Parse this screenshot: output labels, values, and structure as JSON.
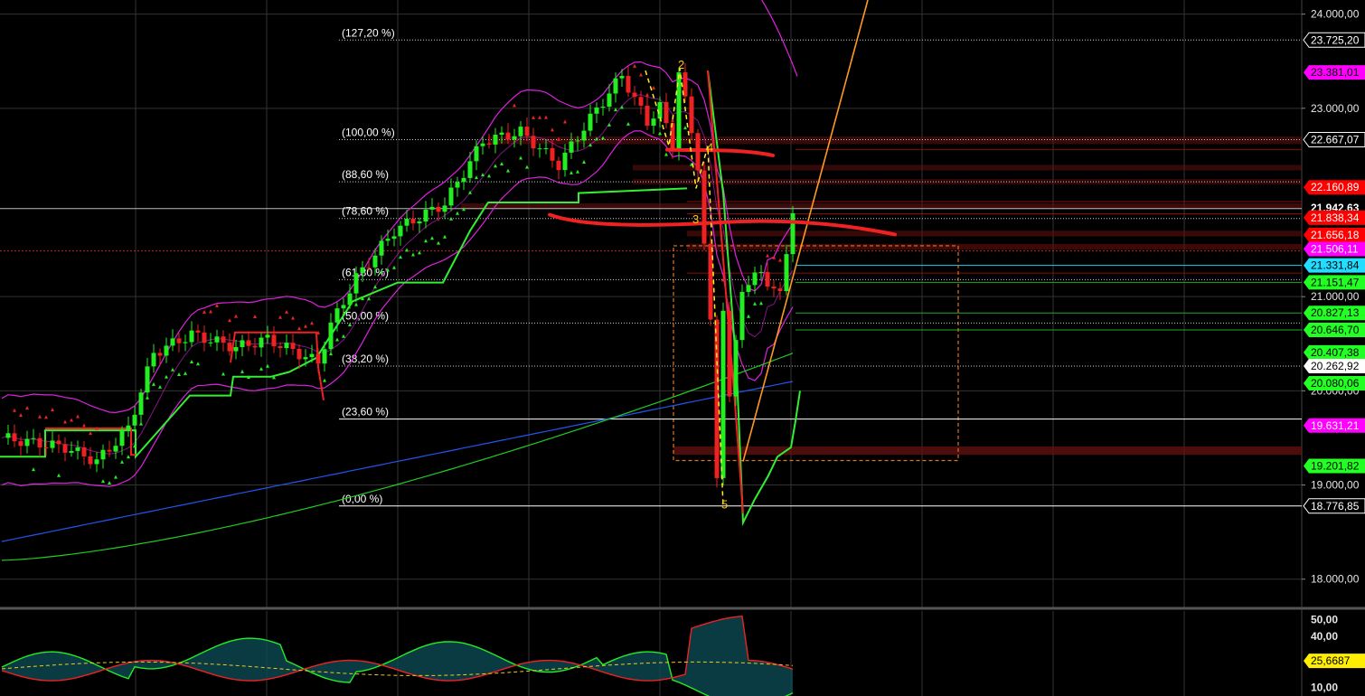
{
  "chart_data": {
    "type": "candlestick",
    "price_axis": {
      "range": [
        17700,
        24150
      ],
      "ticks": [
        {
          "value": 24000,
          "label": "24.000,00"
        },
        {
          "value": 23000,
          "label": "23.000,00"
        },
        {
          "value": 21000,
          "label": "21.000,00"
        },
        {
          "value": 20000,
          "label": "20.000,00"
        },
        {
          "value": 19000,
          "label": "19.000,00"
        },
        {
          "value": 18000,
          "label": "18.000,00"
        }
      ]
    },
    "oscillator_axis": {
      "range": [
        5,
        55
      ],
      "ticks": [
        {
          "value": 50,
          "label": "50,00"
        },
        {
          "value": 40,
          "label": "40,00"
        },
        {
          "value": 10,
          "label": "10,00"
        }
      ]
    },
    "fib_levels": [
      {
        "label": "(127,20 %)",
        "value": 23725.2,
        "color": "#cccccc",
        "style": "dotted"
      },
      {
        "label": "(100,00 %)",
        "value": 22667.07,
        "color": "#cccccc",
        "style": "dotted"
      },
      {
        "label": "(88,60 %)",
        "value": 22220,
        "color": "#cccccc",
        "style": "dotted"
      },
      {
        "label": "(78,60 %)",
        "value": 21830,
        "color": "#cccccc",
        "style": "dotted"
      },
      {
        "label": "(61,80 %)",
        "value": 21180,
        "color": "#cccccc",
        "style": "dotted"
      },
      {
        "label": "(50,00 %)",
        "value": 20720,
        "color": "#cccccc",
        "style": "dotted"
      },
      {
        "label": "(38,20 %)",
        "value": 20262.92,
        "color": "#cccccc",
        "style": "dotted"
      },
      {
        "label": "(23,60 %)",
        "value": 19700,
        "color": "#ffffff",
        "style": "solid"
      },
      {
        "label": "(0,00 %)",
        "value": 18776.85,
        "color": "#ffffff",
        "style": "solid"
      }
    ],
    "price_tags": [
      {
        "label": "23.725,20",
        "value": 23725.2,
        "bg": "#000000",
        "fg": "#ffffff",
        "border": "#ffffff"
      },
      {
        "label": "23.381,01",
        "value": 23381.01,
        "bg": "#ff00ff",
        "fg": "#000000"
      },
      {
        "label": "22.667,07",
        "value": 22667.07,
        "bg": "#000000",
        "fg": "#ffffff",
        "border": "#ffffff"
      },
      {
        "label": "22.160,89",
        "value": 22160.89,
        "bg": "#ff0000",
        "fg": "#ffffff"
      },
      {
        "label": "21.942,63",
        "value": 21942.63,
        "bg": "#000000",
        "fg": "#ffffff",
        "bold": true
      },
      {
        "label": "21.838,34",
        "value": 21838.34,
        "bg": "#ff0000",
        "fg": "#ffffff"
      },
      {
        "label": "21.656,18",
        "value": 21656.18,
        "bg": "#ff0000",
        "fg": "#ffffff"
      },
      {
        "label": "21.506,11",
        "value": 21506.11,
        "bg": "#ff00ff",
        "fg": "#ffffff"
      },
      {
        "label": "21.331,84",
        "value": 21331.84,
        "bg": "#22ddff",
        "fg": "#000000"
      },
      {
        "label": "21.151,47",
        "value": 21151.47,
        "bg": "#22ff22",
        "fg": "#000000"
      },
      {
        "label": "20.827,13",
        "value": 20827.13,
        "bg": "#22ff22",
        "fg": "#000000"
      },
      {
        "label": "20.646,70",
        "value": 20646.7,
        "bg": "#22ff22",
        "fg": "#000000"
      },
      {
        "label": "20.407,38",
        "value": 20407.38,
        "bg": "#22ff22",
        "fg": "#000000"
      },
      {
        "label": "20.262,92",
        "value": 20262.92,
        "bg": "#ffffff",
        "fg": "#000000"
      },
      {
        "label": "20.080,06",
        "value": 20080.06,
        "bg": "#22ff22",
        "fg": "#000000"
      },
      {
        "label": "19.631,21",
        "value": 19631.21,
        "bg": "#ff00ff",
        "fg": "#ffffff"
      },
      {
        "label": "19.201,82",
        "value": 19201.82,
        "bg": "#22ff22",
        "fg": "#000000"
      },
      {
        "label": "18.776,85",
        "value": 18776.85,
        "bg": "#000000",
        "fg": "#ffffff",
        "border": "#ffffff"
      }
    ],
    "oscillator_tags": [
      {
        "label": "25,6687",
        "value": 25.67,
        "bg": "#ffee00",
        "fg": "#000000"
      }
    ],
    "wave_labels": [
      {
        "label": "2",
        "value": 23420,
        "color": "#ffcc00"
      },
      {
        "label": "4",
        "value": 22540,
        "color": "#ffcc00"
      },
      {
        "label": "3",
        "value": 21780,
        "color": "#ffcc00"
      },
      {
        "label": "5",
        "value": 18750,
        "color": "#ffcc00"
      }
    ],
    "colors": {
      "bull": "#22ee22",
      "bear": "#ee2222",
      "fib": "#cccccc",
      "bollinger": "#dd22dd",
      "ma_fast": "#22cc22",
      "ma_slow": "#2255ee",
      "trend": "#ff9922",
      "wave": "#ffee22",
      "zone": "#661111",
      "box": "#dd7722",
      "grid": "#333333"
    }
  }
}
